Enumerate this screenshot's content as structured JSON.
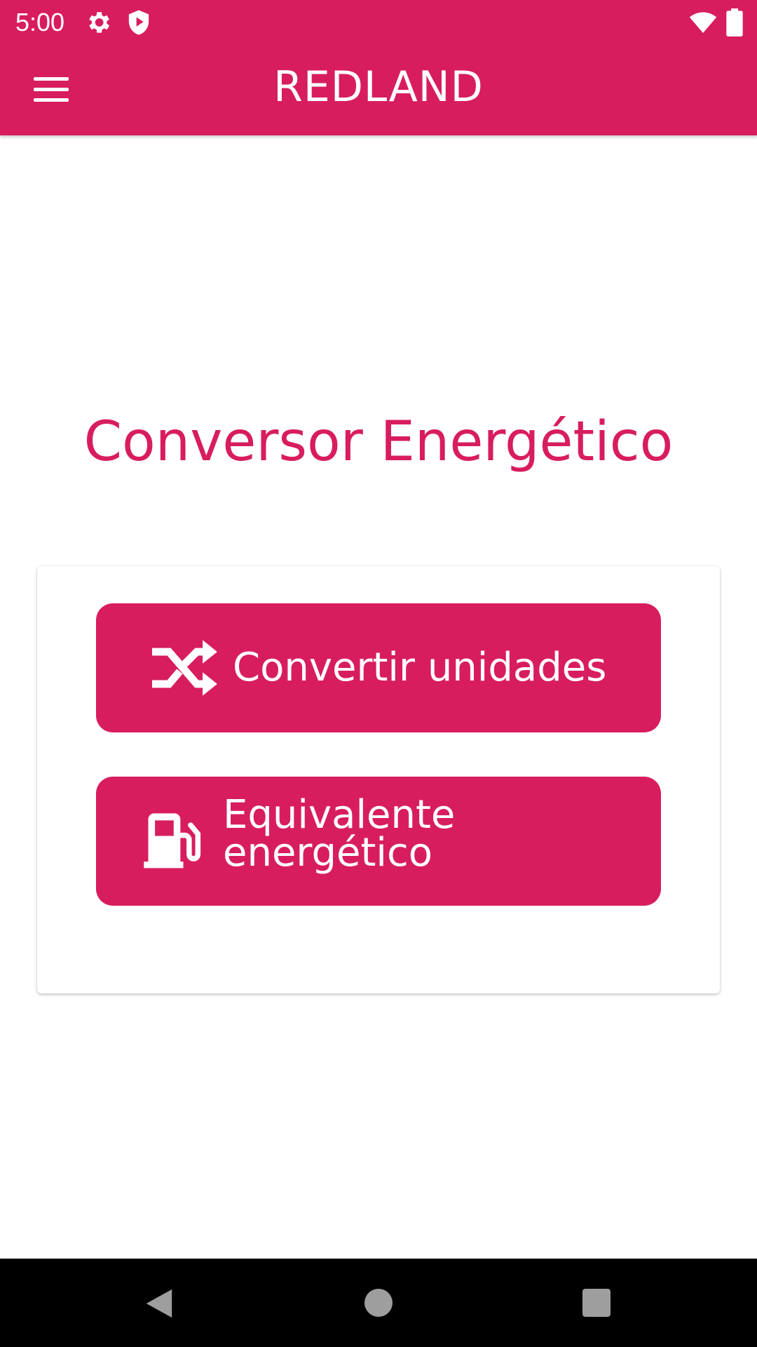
{
  "status_bar": {
    "time": "5:00",
    "icons": [
      "gear-icon",
      "shield-play-icon",
      "wifi-icon",
      "battery-icon"
    ]
  },
  "app_bar": {
    "title": "REDLAND",
    "menu_icon": "hamburger-menu-icon"
  },
  "main": {
    "page_title": "Conversor Energético",
    "buttons": [
      {
        "label": "Convertir unidades",
        "icon": "shuffle-icon"
      },
      {
        "label": "Equivalente energético",
        "icon": "fuel-pump-icon"
      }
    ]
  },
  "nav_bar": {
    "icons": [
      "back-icon",
      "home-icon",
      "recents-icon"
    ]
  },
  "colors": {
    "accent": "#d81d5f",
    "background": "#ffffff",
    "nav_background": "#000000"
  }
}
